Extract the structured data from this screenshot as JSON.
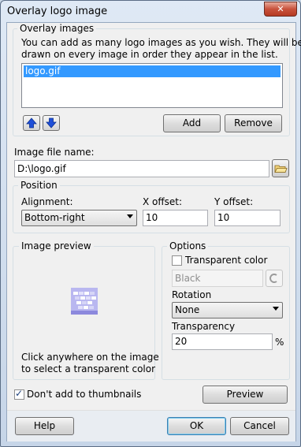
{
  "window": {
    "title": "Overlay logo image",
    "close_glyph": "✕"
  },
  "overlay": {
    "legend": "Overlay images",
    "description_line1": "You can add as many logo images as you wish. They will be",
    "description_line2": "drawn on every image in order they appear in the list.",
    "items": [
      "logo.gif"
    ],
    "add_label": "Add",
    "remove_label": "Remove",
    "move_up_icon": "arrow-up-icon",
    "move_down_icon": "arrow-down-icon"
  },
  "file": {
    "label": "Image file name:",
    "value": "D:\\logo.gif",
    "browse_icon": "folder-open-icon"
  },
  "position": {
    "legend": "Position",
    "alignment_label": "Alignment:",
    "alignment_value": "Bottom-right",
    "x_label": "X offset:",
    "x_value": "10",
    "y_label": "Y offset:",
    "y_value": "10"
  },
  "preview": {
    "legend": "Image preview",
    "hint_line1": "Click anywhere on the image",
    "hint_line2": "to select a transparent color"
  },
  "options": {
    "legend": "Options",
    "transparent_label": "Transparent color",
    "transparent_checked": false,
    "color_value": "Black",
    "rotation_label": "Rotation",
    "rotation_value": "None",
    "transparency_label": "Transparency",
    "transparency_value": "20",
    "transparency_unit": "%"
  },
  "thumbnails": {
    "label": "Don't add to thumbnails",
    "checked": true
  },
  "buttons": {
    "preview": "Preview",
    "help": "Help",
    "ok": "OK",
    "cancel": "Cancel"
  },
  "colors": {
    "selection": "#3399ff",
    "arrow_blue": "#1f4fd8",
    "default_button_border": "#3c7fb1"
  }
}
